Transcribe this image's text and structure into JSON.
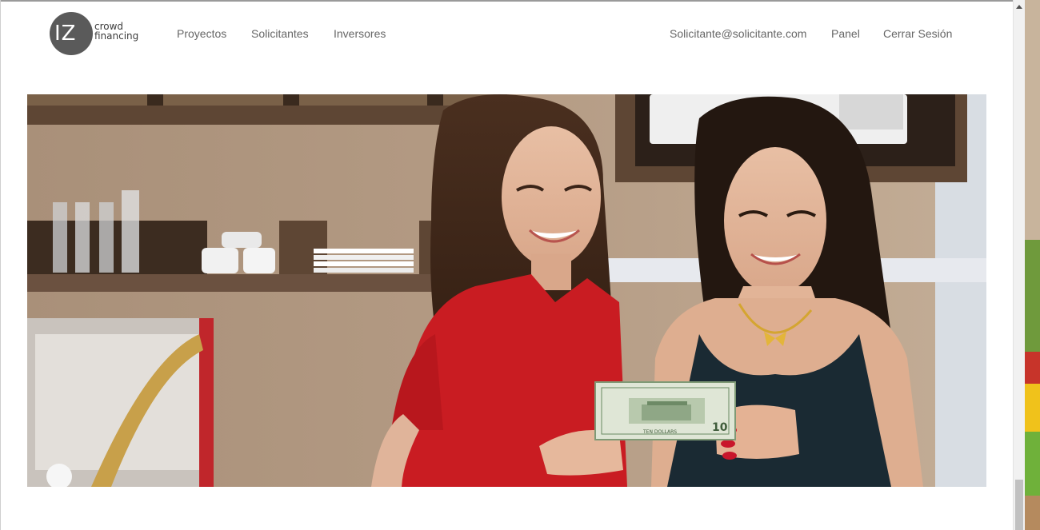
{
  "header": {
    "logo": {
      "mark": "IZ",
      "line1": "crowd",
      "line2": "financing"
    },
    "nav_left": [
      "Proyectos",
      "Solicitantes",
      "Inversores"
    ],
    "user_email": "Solicitante@solicitante.com",
    "panel_label": "Panel",
    "logout_label": "Cerrar Sesión"
  },
  "hero": {
    "banknote_text": "TEN DOLLARS",
    "banknote_value": "10"
  },
  "colors": {
    "nav_text": "#666666",
    "logo_circle": "#5a5a5a",
    "shirt_red": "#c91c22",
    "wall": "#b0977f"
  }
}
